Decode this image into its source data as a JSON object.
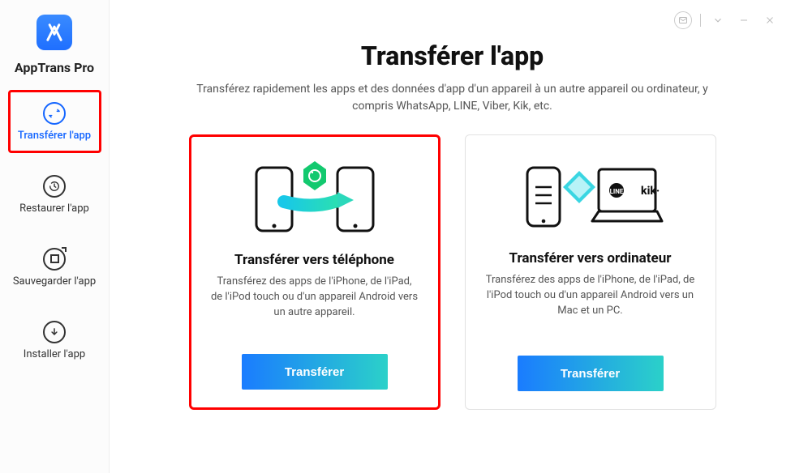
{
  "brand": "AppTrans Pro",
  "sidebar": {
    "items": [
      {
        "label": "Transférer l'app"
      },
      {
        "label": "Restaurer l'app"
      },
      {
        "label": "Sauvegarder l'app"
      },
      {
        "label": "Installer l'app"
      }
    ]
  },
  "page": {
    "title": "Transférer l'app",
    "subtitle": "Transférez rapidement les apps et des données d'app d'un appareil à un autre appareil ou ordinateur, y compris WhatsApp, LINE, Viber, Kik, etc."
  },
  "cards": [
    {
      "title": "Transférer vers téléphone",
      "desc": "Transférez des apps de l'iPhone, de l'iPad, de l'iPod touch ou d'un appareil Android vers un autre appareil.",
      "button": "Transférer"
    },
    {
      "title": "Transférer vers ordinateur",
      "desc": "Transférez des apps de l'iPhone, de l'iPad, de l'iPod touch ou d'un appareil Android vers un Mac et un PC.",
      "button": "Transférer"
    }
  ]
}
